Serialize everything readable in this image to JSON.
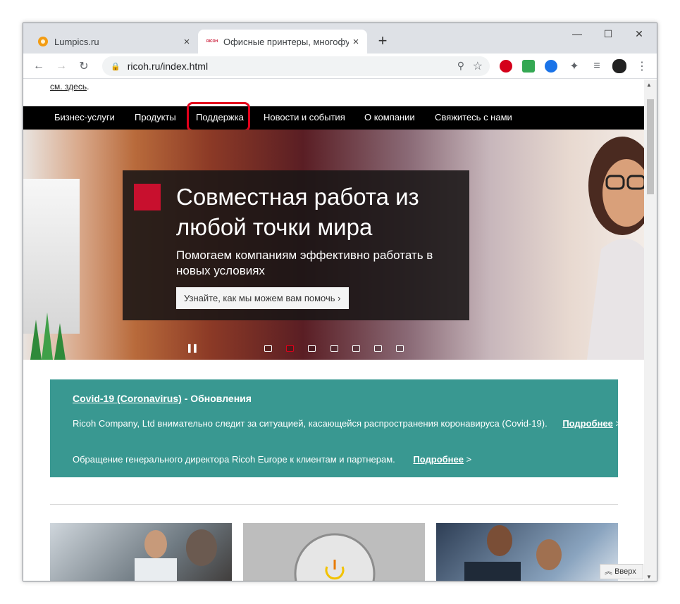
{
  "browser": {
    "tabs": [
      {
        "title": "Lumpics.ru",
        "close": "×"
      },
      {
        "title": "Офисные принтеры, многофун",
        "close": "×",
        "favicon_text": "RICOH"
      }
    ],
    "new_tab": "+",
    "window_controls": {
      "minimize": "—",
      "maximize": "☐",
      "close": "✕"
    },
    "address": "ricoh.ru/index.html"
  },
  "page": {
    "top_link": "см. здесь",
    "top_link_suffix": ".",
    "nav": [
      "Бизнес-услуги",
      "Продукты",
      "Поддержка",
      "Новости и события",
      "О компании",
      "Свяжитесь с нами"
    ],
    "hero": {
      "title": "Совместная работа из любой точки мира",
      "subtitle": "Помогаем компаниям эффективно работать в новых условиях",
      "button": "Узнайте, как мы можем вам помочь ›",
      "pause": "▌▌",
      "active_slide": 2,
      "slide_count": 7
    },
    "covid": {
      "title_link": "Covid-19 (Coronavirus)",
      "title_rest": " - Обновления",
      "line1": "Ricoh Company, Ltd внимательно следит за ситуацией, касающейся распространения коронавируса (Covid-19).",
      "line2": "Обращение генерального директора Ricoh Europe к клиентам и партнерам.",
      "more_label": "Подробнее",
      "more_arrow": " >"
    },
    "back_to_top": "Вверх"
  },
  "colors": {
    "nav_bg": "#000000",
    "highlight": "#e3001b",
    "covid_bg": "#399891",
    "brand_red": "#c8102e"
  }
}
